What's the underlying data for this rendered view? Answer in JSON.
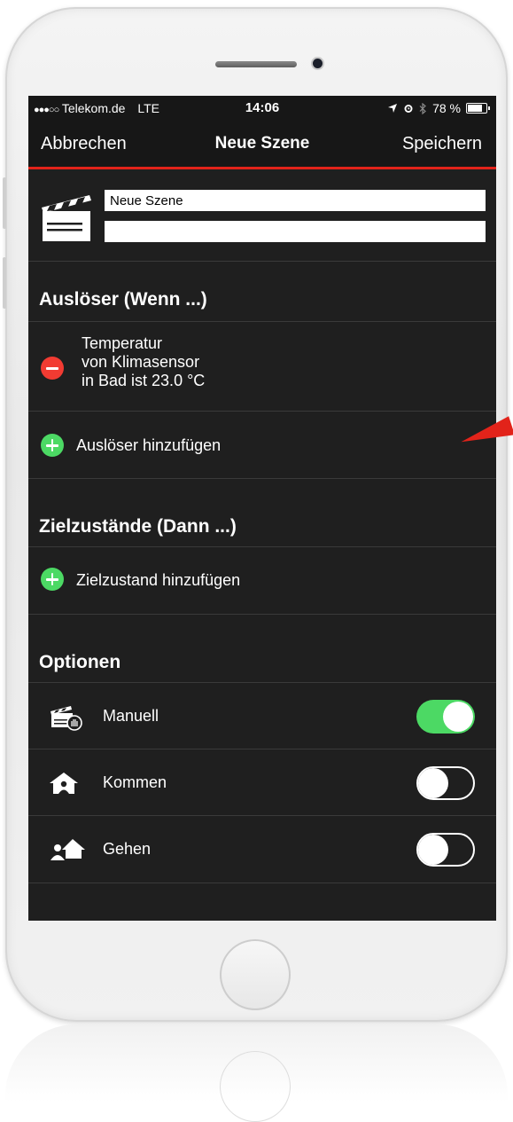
{
  "status_bar": {
    "carrier": "Telekom.de",
    "network": "LTE",
    "time": "14:06",
    "battery": "78 %",
    "battery_level": 0.78,
    "signal_dots": "●●●○○"
  },
  "nav": {
    "cancel": "Abbrechen",
    "title": "Neue Szene",
    "save": "Speichern"
  },
  "scene": {
    "name_value": "Neue Szene",
    "description_value": ""
  },
  "triggers": {
    "title": "Auslöser (Wenn ...)",
    "items": [
      {
        "line1": "Temperatur",
        "line2": "von Klimasensor",
        "line3": "in Bad ist 23.0 °C"
      }
    ],
    "add_label": "Auslöser hinzufügen"
  },
  "targets": {
    "title": "Zielzustände (Dann ...)",
    "add_label": "Zielzustand hinzufügen"
  },
  "options": {
    "title": "Optionen",
    "items": [
      {
        "label": "Manuell",
        "icon": "manual-scene-icon",
        "enabled": true
      },
      {
        "label": "Kommen",
        "icon": "arrive-home-icon",
        "enabled": false
      },
      {
        "label": "Gehen",
        "icon": "leave-home-icon",
        "enabled": false
      }
    ]
  },
  "colors": {
    "accent": "#e2231a",
    "toggle_on": "#4cd964",
    "remove": "#f23b32",
    "background": "#1f1f1f"
  }
}
